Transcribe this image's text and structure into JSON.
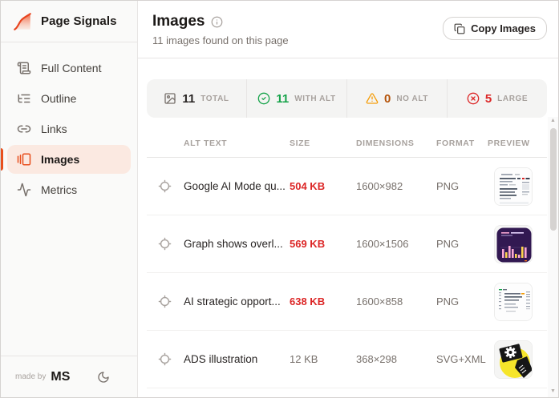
{
  "app": {
    "title": "Page Signals",
    "logo_icon": "signal-chart-icon"
  },
  "sidebar": {
    "items": [
      {
        "icon": "scroll-text-icon",
        "label": "Full Content",
        "active": false
      },
      {
        "icon": "list-tree-icon",
        "label": "Outline",
        "active": false
      },
      {
        "icon": "link-icon",
        "label": "Links",
        "active": false
      },
      {
        "icon": "gallery-icon",
        "label": "Images",
        "active": true
      },
      {
        "icon": "activity-icon",
        "label": "Metrics",
        "active": false
      }
    ],
    "footer": {
      "made_by_label": "made by",
      "author": "MS",
      "theme_toggle_icon": "moon-icon"
    }
  },
  "header": {
    "title": "Images",
    "info_icon": "info-icon",
    "subtitle": "11 images found on this page",
    "copy_button_label": "Copy Images",
    "copy_button_icon": "copy-icon"
  },
  "stats": [
    {
      "icon": "image-icon",
      "value": "11",
      "label": "TOTAL",
      "value_color": "#292524"
    },
    {
      "icon": "check-circle-icon",
      "value": "11",
      "label": "WITH ALT",
      "value_color": "#16a34a"
    },
    {
      "icon": "alert-triangle-icon",
      "value": "0",
      "label": "NO ALT",
      "value_color": "#b45309"
    },
    {
      "icon": "x-circle-icon",
      "value": "5",
      "label": "LARGE",
      "value_color": "#dc2626"
    }
  ],
  "table": {
    "columns": [
      "ALT TEXT",
      "SIZE",
      "DIMENSIONS",
      "FORMAT",
      "PREVIEW"
    ],
    "rows": [
      {
        "alt": "Google AI Mode qu...",
        "size": "504 KB",
        "size_warning": true,
        "dimensions": "1600×982",
        "format": "PNG",
        "preview": "light-screenshot-thumbnail"
      },
      {
        "alt": "Graph shows overl...",
        "size": "569 KB",
        "size_warning": true,
        "dimensions": "1600×1506",
        "format": "PNG",
        "preview": "dark-purple-bar-chart-thumbnail"
      },
      {
        "alt": "AI strategic opport...",
        "size": "638 KB",
        "size_warning": true,
        "dimensions": "1600×858",
        "format": "PNG",
        "preview": "light-document-thumbnail"
      },
      {
        "alt": "ADS illustration",
        "size": "12 KB",
        "size_warning": false,
        "dimensions": "368×298",
        "format": "SVG+XML",
        "preview": "yellow-illustration-thumbnail"
      }
    ]
  },
  "colors": {
    "accent": "#e8501e",
    "accent_bg": "#fbe9e1",
    "danger": "#dc2626",
    "success": "#16a34a",
    "warning": "#f59e0b",
    "muted_text": "#a8a29e",
    "border": "#e7e5e4",
    "sidebar_bg": "#fafaf9",
    "stats_bg": "#f4f4f3"
  }
}
